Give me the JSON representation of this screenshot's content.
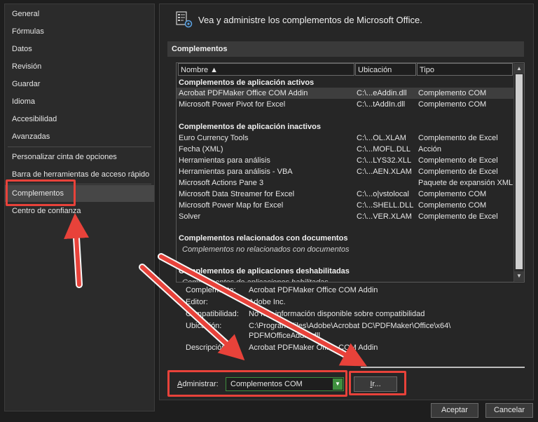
{
  "sidebar": {
    "items": [
      {
        "label": "General"
      },
      {
        "label": "Fórmulas"
      },
      {
        "label": "Datos"
      },
      {
        "label": "Revisión"
      },
      {
        "label": "Guardar"
      },
      {
        "label": "Idioma"
      },
      {
        "label": "Accesibilidad"
      },
      {
        "label": "Avanzadas"
      },
      {
        "label": "Personalizar cinta de opciones"
      },
      {
        "label": "Barra de herramientas de acceso rápido"
      },
      {
        "label": "Complementos",
        "selected": true
      },
      {
        "label": "Centro de confianza"
      }
    ]
  },
  "header": {
    "icon": "addins-gear-icon",
    "text": "Vea y administre los complementos de Microsoft Office."
  },
  "section": {
    "title": "Complementos"
  },
  "list": {
    "columns": [
      "Nombre ▲",
      "Ubicación",
      "Tipo"
    ],
    "groups": {
      "active": "Complementos de aplicación activos",
      "inactive": "Complementos de aplicación inactivos",
      "document": "Complementos relacionados con documentos",
      "document_note": "Complementos no relacionados con documentos",
      "disabled": "Complementos de aplicaciones deshabilitadas",
      "disabled_note": "Complementos de aplicaciones habilitadas"
    },
    "active_rows": [
      {
        "name": "Acrobat PDFMaker Office COM Addin",
        "location": "C:\\...eAddin.dll",
        "type": "Complemento COM",
        "selected": true
      },
      {
        "name": "Microsoft Power Pivot for Excel",
        "location": "C:\\...tAddIn.dll",
        "type": "Complemento COM"
      }
    ],
    "inactive_rows": [
      {
        "name": "Euro Currency Tools",
        "location": "C:\\...OL.XLAM",
        "type": "Complemento de Excel"
      },
      {
        "name": "Fecha (XML)",
        "location": "C:\\...MOFL.DLL",
        "type": "Acción"
      },
      {
        "name": "Herramientas para análisis",
        "location": "C:\\...LYS32.XLL",
        "type": "Complemento de Excel"
      },
      {
        "name": "Herramientas para análisis - VBA",
        "location": "C:\\...AEN.XLAM",
        "type": "Complemento de Excel"
      },
      {
        "name": "Microsoft Actions Pane 3",
        "location": "",
        "type": "Paquete de expansión XML"
      },
      {
        "name": "Microsoft Data Streamer for Excel",
        "location": "C:\\...o|vstolocal",
        "type": "Complemento COM"
      },
      {
        "name": "Microsoft Power Map for Excel",
        "location": "C:\\...SHELL.DLL",
        "type": "Complemento COM"
      },
      {
        "name": "Solver",
        "location": "C:\\...VER.XLAM",
        "type": "Complemento de Excel"
      }
    ]
  },
  "details": {
    "addin_label": "Complemento:",
    "addin_value": "Acrobat PDFMaker Office COM Addin",
    "publisher_label": "Editor:",
    "publisher_value": "Adobe Inc.",
    "compat_label": "Compatibilidad:",
    "compat_value": "No hay información disponible sobre compatibilidad",
    "location_label": "Ubicación:",
    "location_value_1": "C:\\Program Files\\Adobe\\Acrobat DC\\PDFMaker\\Office\\x64\\",
    "location_value_2": "PDFMOfficeAddin.dll",
    "desc_label": "Descripción:",
    "desc_value": "Acrobat PDFMaker Office COM Addin"
  },
  "manage": {
    "label_underlined": "A",
    "label_rest": "dministrar:",
    "selected": "Complementos COM",
    "go_underlined": "I",
    "go_rest": "r..."
  },
  "footer": {
    "ok": "Aceptar",
    "cancel": "Cancelar"
  },
  "colors": {
    "annotation": "#e8423a",
    "accent": "#3f8f3f"
  }
}
